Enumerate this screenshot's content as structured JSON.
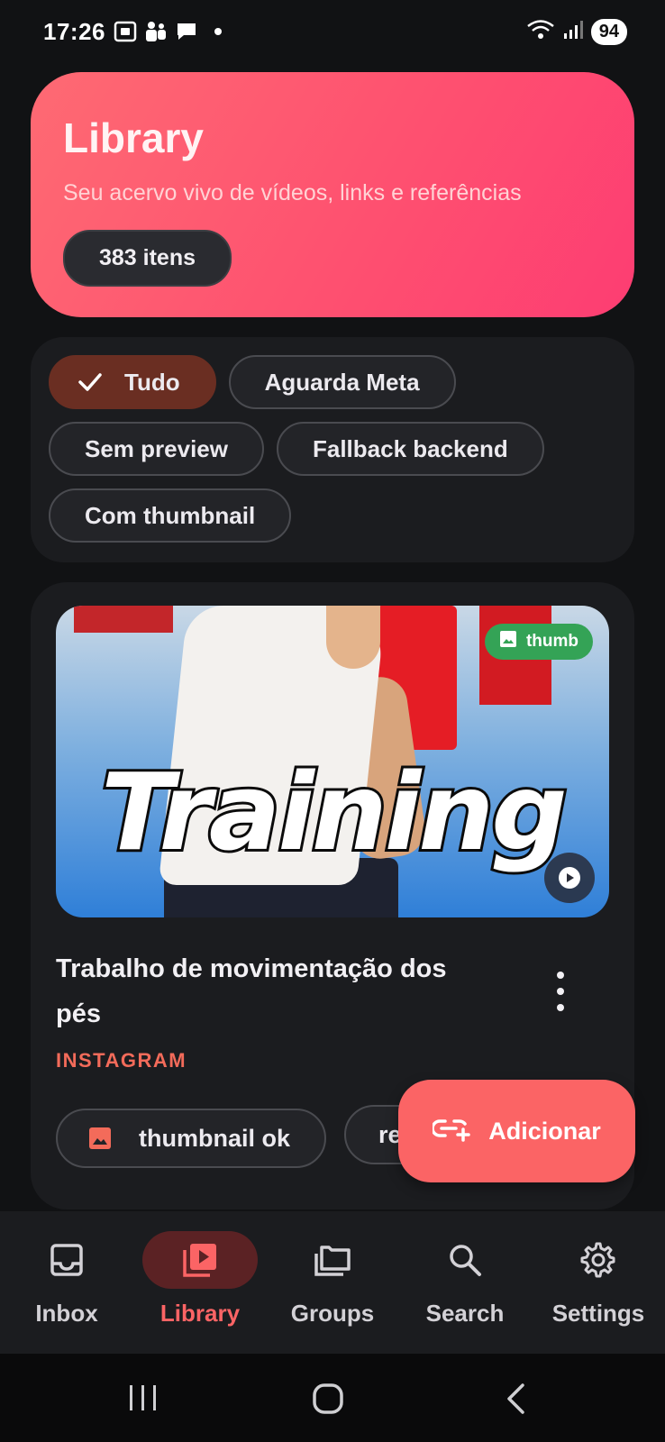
{
  "status_bar": {
    "time": "17:26",
    "battery": "94",
    "icons": [
      "screenshot-icon",
      "teams-icon",
      "chat-bubble-icon",
      "notification-dot",
      "wifi-icon",
      "signal-icon"
    ]
  },
  "hero": {
    "title": "Library",
    "subtitle": "Seu acervo vivo de vídeos, links e referências",
    "count": "383 itens"
  },
  "filters": {
    "chips": [
      {
        "label": "Tudo",
        "selected": true
      },
      {
        "label": "Aguarda Meta",
        "selected": false
      },
      {
        "label": "Sem preview",
        "selected": false
      },
      {
        "label": "Fallback backend",
        "selected": false
      },
      {
        "label": "Com thumbnail",
        "selected": false
      }
    ]
  },
  "card": {
    "thumbnail_text": "Training",
    "badge": "thumb",
    "title": "Trabalho de movimentação dos pés",
    "source": "INSTAGRAM",
    "tags": [
      "thumbnail ok",
      "re"
    ]
  },
  "fab": {
    "label": "Adicionar"
  },
  "bottom_nav": {
    "items": [
      {
        "label": "Inbox",
        "icon": "inbox-icon",
        "active": false
      },
      {
        "label": "Library",
        "icon": "video-library-icon",
        "active": true
      },
      {
        "label": "Groups",
        "icon": "folders-icon",
        "active": false
      },
      {
        "label": "Search",
        "icon": "search-icon",
        "active": false
      },
      {
        "label": "Settings",
        "icon": "gear-icon",
        "active": false
      }
    ]
  },
  "colors": {
    "accent": "#fb6465",
    "hero_gradient_start": "#fe6a73",
    "hero_gradient_end": "#fd3d72",
    "selected_chip": "#6a2e22",
    "source_label": "#f36b5a",
    "badge_green": "#34a356"
  }
}
